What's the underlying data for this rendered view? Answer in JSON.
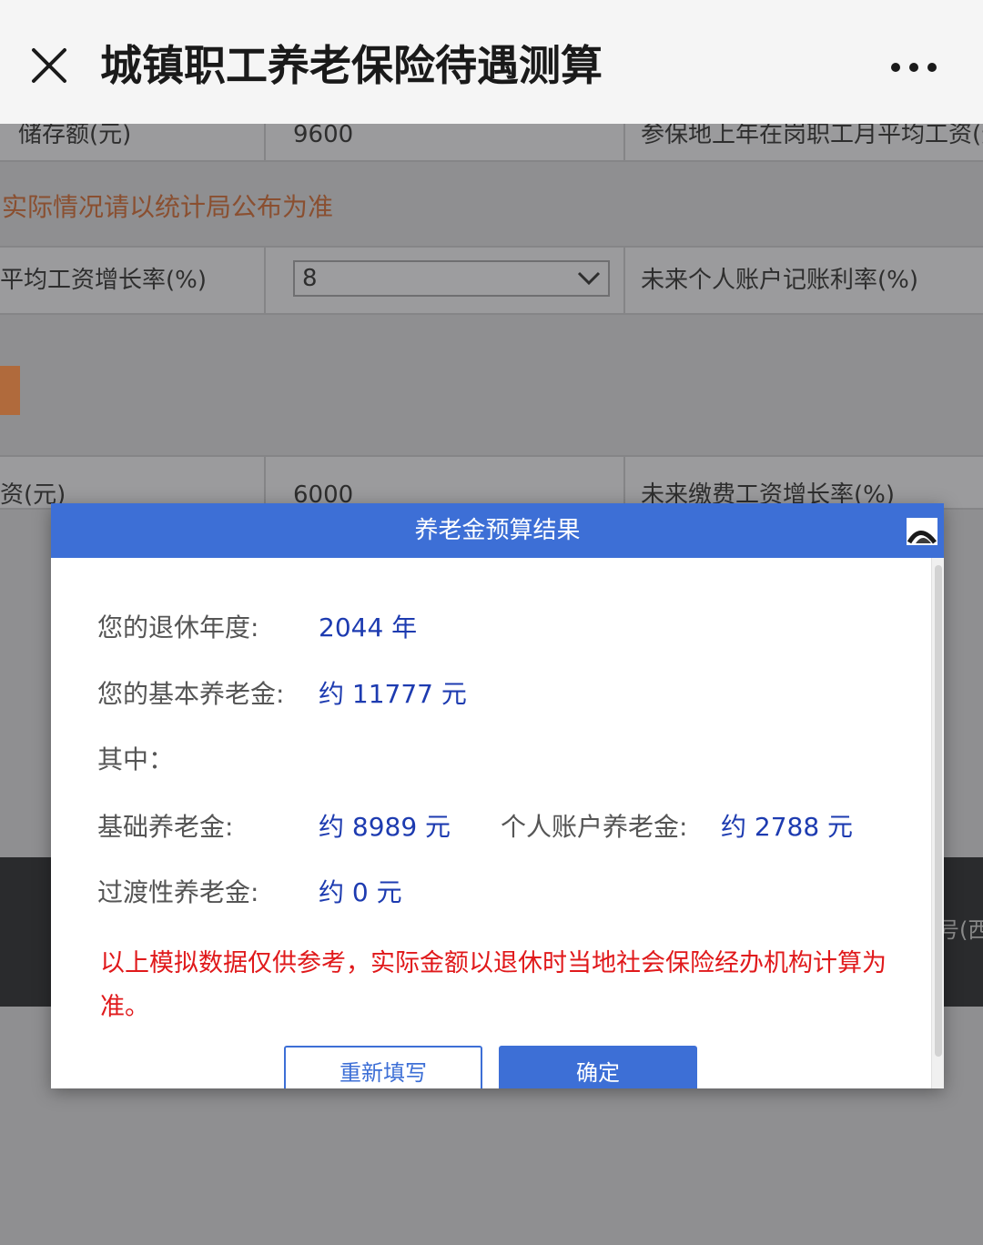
{
  "nav": {
    "title": "城镇职工养老保险待遇测算",
    "close_icon": "close-icon",
    "more_icon": "more-icon"
  },
  "background": {
    "row1": {
      "label": "储存额(元)",
      "value": "9600",
      "right_label": "参保地上年在岗职工月平均工资(元"
    },
    "notice": "实际情况请以统计局公布为准",
    "row2": {
      "label": "平均工资增长率(%)",
      "select_value": "8",
      "right_label": "未来个人账户记账利率(%)"
    },
    "row3": {
      "label": "资(元)",
      "value": "6000",
      "right_label": "未来缴费工资增长率(%)"
    },
    "dark_bar_text": "号(西"
  },
  "modal": {
    "title": "养老金预算结果",
    "retire_year_label": "您的退休年度:",
    "retire_year_value": "2044 年",
    "basic_pension_label": "您的基本养老金:",
    "basic_pension_value": "约 11777 元",
    "breakdown_label": "其中：",
    "base_pension_label": "基础养老金:",
    "base_pension_value": "约 8989 元",
    "personal_pension_label": "个人账户养老金:",
    "personal_pension_value": "约 2788 元",
    "transition_pension_label": "过渡性养老金:",
    "transition_pension_value": "约 0 元",
    "disclaimer": "以上模拟数据仅供参考，实际金额以退休时当地社会保险经办机构计算为准。",
    "refill_button": "重新填写",
    "confirm_button": "确定"
  },
  "colors": {
    "accent": "#3d6fd6",
    "value_text": "#1d3bb0",
    "warning": "#e0191b",
    "overlay": "#8f8f91"
  }
}
